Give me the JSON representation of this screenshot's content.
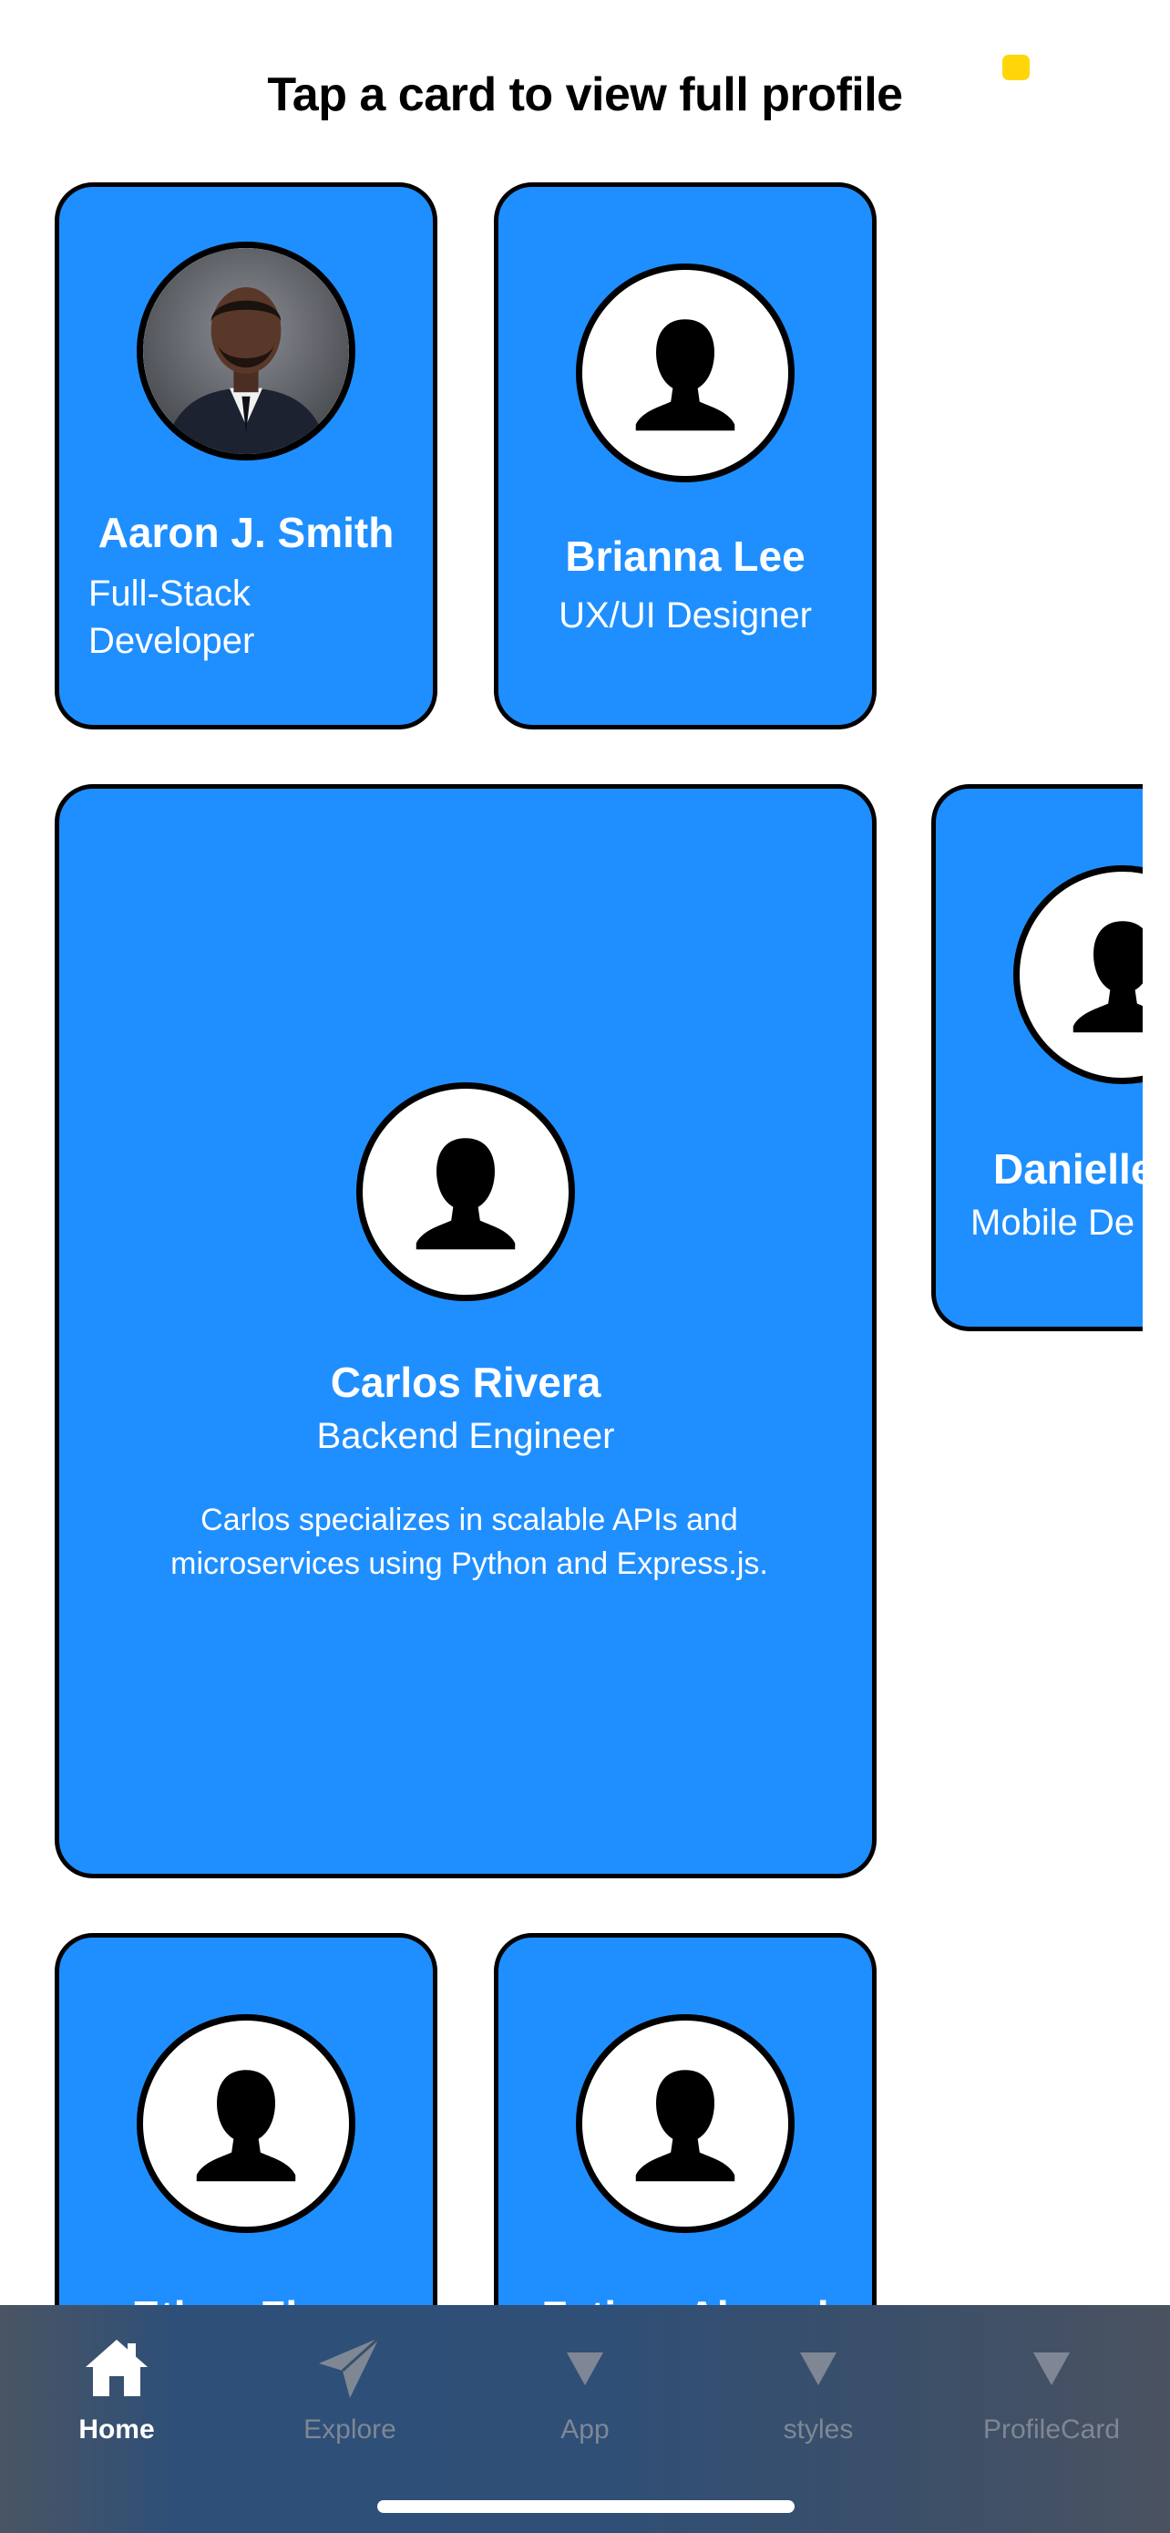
{
  "header": {
    "title": "Tap a card to view full profile"
  },
  "colors": {
    "card_blue": "#1f8fff",
    "status_dot": "#ffd60a",
    "tab_active": "#ffffff",
    "tab_inactive": "#7f8794"
  },
  "cards": [
    {
      "name": "Aaron J. Smith",
      "role": "Full-Stack Developer",
      "avatar": "photo"
    },
    {
      "name": "Brianna Lee",
      "role": "UX/UI Designer",
      "avatar": "silhouette-icon"
    },
    {
      "name": "Carlos Rivera",
      "role": "Backend Engineer",
      "bio": "Carlos specializes in scalable APIs and microservices using Python and Express.js.",
      "avatar": "silhouette-icon"
    },
    {
      "name": "Danielle",
      "role": "Mobile De",
      "avatar": "silhouette-icon"
    },
    {
      "name": "Ethan Zhao",
      "avatar": "silhouette-icon"
    },
    {
      "name": "Fatima Ahmed",
      "avatar": "silhouette-icon"
    }
  ],
  "tabs": [
    {
      "label": "Home",
      "icon": "home-icon",
      "active": true
    },
    {
      "label": "Explore",
      "icon": "paper-plane-icon",
      "active": false
    },
    {
      "label": "App",
      "icon": "triangle-down-icon",
      "active": false
    },
    {
      "label": "styles",
      "icon": "triangle-down-icon",
      "active": false
    },
    {
      "label": "ProfileCard",
      "icon": "triangle-down-icon",
      "active": false
    }
  ]
}
